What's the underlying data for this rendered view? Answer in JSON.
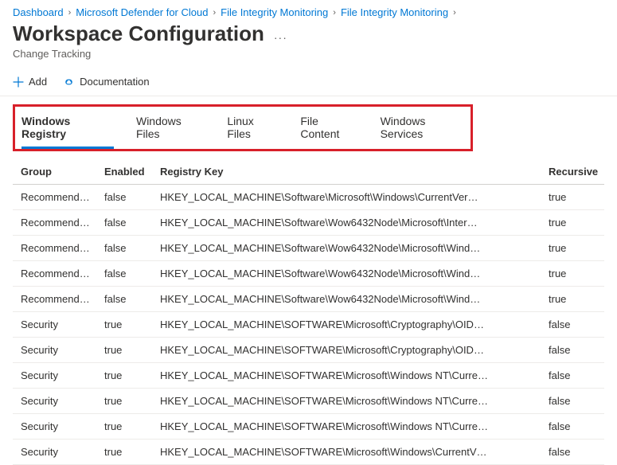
{
  "breadcrumb": [
    "Dashboard",
    "Microsoft Defender for Cloud",
    "File Integrity Monitoring",
    "File Integrity Monitoring"
  ],
  "title": "Workspace Configuration",
  "subtitle": "Change Tracking",
  "toolbar": {
    "add_label": "Add",
    "doc_label": "Documentation"
  },
  "tabs": [
    {
      "label": "Windows Registry",
      "active": true
    },
    {
      "label": "Windows Files",
      "active": false
    },
    {
      "label": "Linux Files",
      "active": false
    },
    {
      "label": "File Content",
      "active": false
    },
    {
      "label": "Windows Services",
      "active": false
    }
  ],
  "table": {
    "headers": {
      "group": "Group",
      "enabled": "Enabled",
      "registry_key": "Registry Key",
      "recursive": "Recursive"
    },
    "rows": [
      {
        "group": "Recommended",
        "enabled": "false",
        "registry_key": "HKEY_LOCAL_MACHINE\\Software\\Microsoft\\Windows\\CurrentVer…",
        "recursive": "true"
      },
      {
        "group": "Recommended",
        "enabled": "false",
        "registry_key": "HKEY_LOCAL_MACHINE\\Software\\Wow6432Node\\Microsoft\\Inter…",
        "recursive": "true"
      },
      {
        "group": "Recommended",
        "enabled": "false",
        "registry_key": "HKEY_LOCAL_MACHINE\\Software\\Wow6432Node\\Microsoft\\Wind…",
        "recursive": "true"
      },
      {
        "group": "Recommended",
        "enabled": "false",
        "registry_key": "HKEY_LOCAL_MACHINE\\Software\\Wow6432Node\\Microsoft\\Wind…",
        "recursive": "true"
      },
      {
        "group": "Recommended",
        "enabled": "false",
        "registry_key": "HKEY_LOCAL_MACHINE\\Software\\Wow6432Node\\Microsoft\\Wind…",
        "recursive": "true"
      },
      {
        "group": "Security",
        "enabled": "true",
        "registry_key": "HKEY_LOCAL_MACHINE\\SOFTWARE\\Microsoft\\Cryptography\\OID…",
        "recursive": "false"
      },
      {
        "group": "Security",
        "enabled": "true",
        "registry_key": "HKEY_LOCAL_MACHINE\\SOFTWARE\\Microsoft\\Cryptography\\OID…",
        "recursive": "false"
      },
      {
        "group": "Security",
        "enabled": "true",
        "registry_key": "HKEY_LOCAL_MACHINE\\SOFTWARE\\Microsoft\\Windows NT\\Curre…",
        "recursive": "false"
      },
      {
        "group": "Security",
        "enabled": "true",
        "registry_key": "HKEY_LOCAL_MACHINE\\SOFTWARE\\Microsoft\\Windows NT\\Curre…",
        "recursive": "false"
      },
      {
        "group": "Security",
        "enabled": "true",
        "registry_key": "HKEY_LOCAL_MACHINE\\SOFTWARE\\Microsoft\\Windows NT\\Curre…",
        "recursive": "false"
      },
      {
        "group": "Security",
        "enabled": "true",
        "registry_key": "HKEY_LOCAL_MACHINE\\SOFTWARE\\Microsoft\\Windows\\CurrentV…",
        "recursive": "false"
      }
    ]
  }
}
